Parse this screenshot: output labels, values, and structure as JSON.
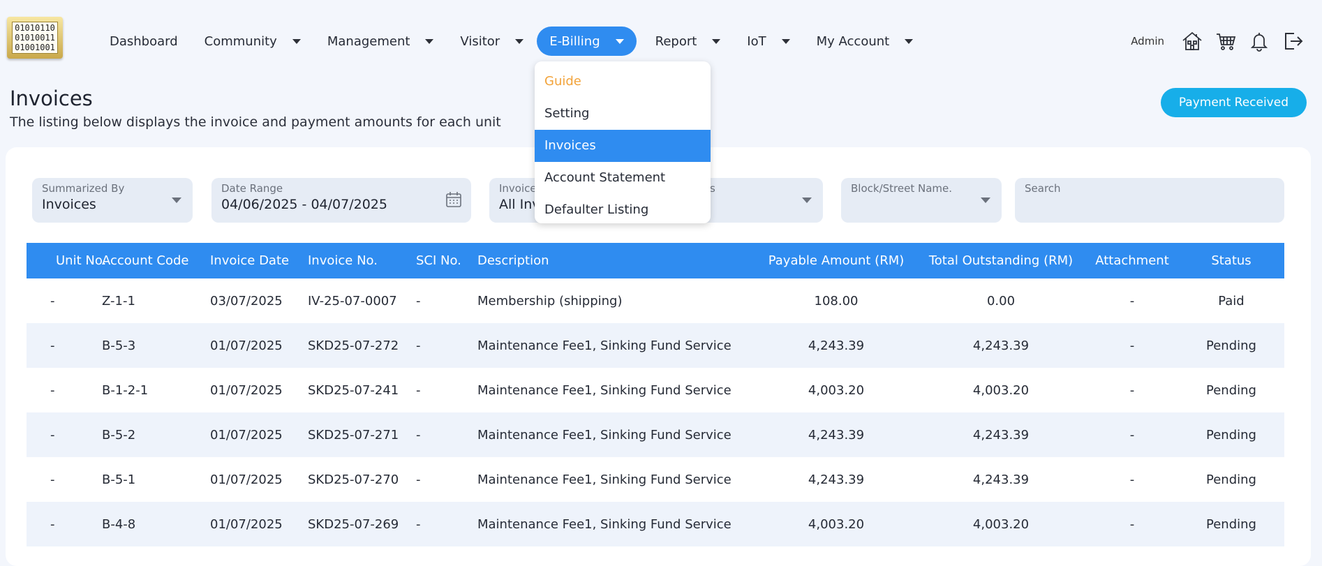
{
  "logo": {
    "lines": [
      "01010110",
      "01010011",
      "01001001"
    ]
  },
  "nav": {
    "items": [
      {
        "label": "Dashboard",
        "has_caret": false
      },
      {
        "label": "Community",
        "has_caret": true
      },
      {
        "label": "Management",
        "has_caret": true
      },
      {
        "label": "Visitor",
        "has_caret": true
      },
      {
        "label": "E-Billing",
        "has_caret": true,
        "active": true
      },
      {
        "label": "Report",
        "has_caret": true
      },
      {
        "label": "IoT",
        "has_caret": true
      },
      {
        "label": "My Account",
        "has_caret": true
      }
    ],
    "active_color": "#2f8cf0"
  },
  "user": {
    "name": "Admin",
    "icons": [
      "home-unit-icon",
      "cart-icon",
      "bell-icon",
      "logout-icon"
    ]
  },
  "page": {
    "title": "Invoices",
    "subtitle": "The listing below displays the invoice and payment amounts for each unit",
    "payment_button": "Payment Received",
    "payment_button_color": "#17aee9"
  },
  "filters": {
    "summarized_by": {
      "label": "Summarized By",
      "value": "Invoices"
    },
    "date_range": {
      "label": "Date Range",
      "value": "04/06/2025 - 04/07/2025"
    },
    "invoice_type": {
      "label": "Invoice",
      "value": "All Inv"
    },
    "status": {
      "label": "s",
      "value": ""
    },
    "block": {
      "label": "Block/Street Name.",
      "value": ""
    },
    "search": {
      "label": "Search",
      "value": ""
    }
  },
  "dropdown": {
    "items": [
      "Guide",
      "Setting",
      "Invoices",
      "Account Statement",
      "Defaulter Listing"
    ],
    "active_index": 2
  },
  "table": {
    "headers": {
      "unit": "Unit No.",
      "account": "Account Code",
      "date": "Invoice Date",
      "invoice": "Invoice No.",
      "sci": "SCI No.",
      "description": "Description",
      "payable": "Payable Amount (RM)",
      "outstanding": "Total Outstanding (RM)",
      "attachment": "Attachment",
      "status": "Status"
    },
    "rows": [
      {
        "unit": "-",
        "account": "Z-1-1",
        "date": "03/07/2025",
        "invoice": "IV-25-07-0007",
        "sci": "-",
        "description": "Membership (shipping)",
        "payable": "108.00",
        "outstanding": "0.00",
        "attachment": "-",
        "status": "Paid"
      },
      {
        "unit": "-",
        "account": "B-5-3",
        "date": "01/07/2025",
        "invoice": "SKD25-07-272",
        "sci": "-",
        "description": "Maintenance Fee1, Sinking Fund Service",
        "payable": "4,243.39",
        "outstanding": "4,243.39",
        "attachment": "-",
        "status": "Pending"
      },
      {
        "unit": "-",
        "account": "B-1-2-1",
        "date": "01/07/2025",
        "invoice": "SKD25-07-241",
        "sci": "-",
        "description": "Maintenance Fee1, Sinking Fund Service",
        "payable": "4,003.20",
        "outstanding": "4,003.20",
        "attachment": "-",
        "status": "Pending"
      },
      {
        "unit": "-",
        "account": "B-5-2",
        "date": "01/07/2025",
        "invoice": "SKD25-07-271",
        "sci": "-",
        "description": "Maintenance Fee1, Sinking Fund Service",
        "payable": "4,243.39",
        "outstanding": "4,243.39",
        "attachment": "-",
        "status": "Pending"
      },
      {
        "unit": "-",
        "account": "B-5-1",
        "date": "01/07/2025",
        "invoice": "SKD25-07-270",
        "sci": "-",
        "description": "Maintenance Fee1, Sinking Fund Service",
        "payable": "4,243.39",
        "outstanding": "4,243.39",
        "attachment": "-",
        "status": "Pending"
      },
      {
        "unit": "-",
        "account": "B-4-8",
        "date": "01/07/2025",
        "invoice": "SKD25-07-269",
        "sci": "-",
        "description": "Maintenance Fee1, Sinking Fund Service",
        "payable": "4,003.20",
        "outstanding": "4,003.20",
        "attachment": "-",
        "status": "Pending"
      }
    ],
    "status_colors": {
      "Paid": "#3cc03c",
      "Pending": "#f2902f"
    }
  }
}
